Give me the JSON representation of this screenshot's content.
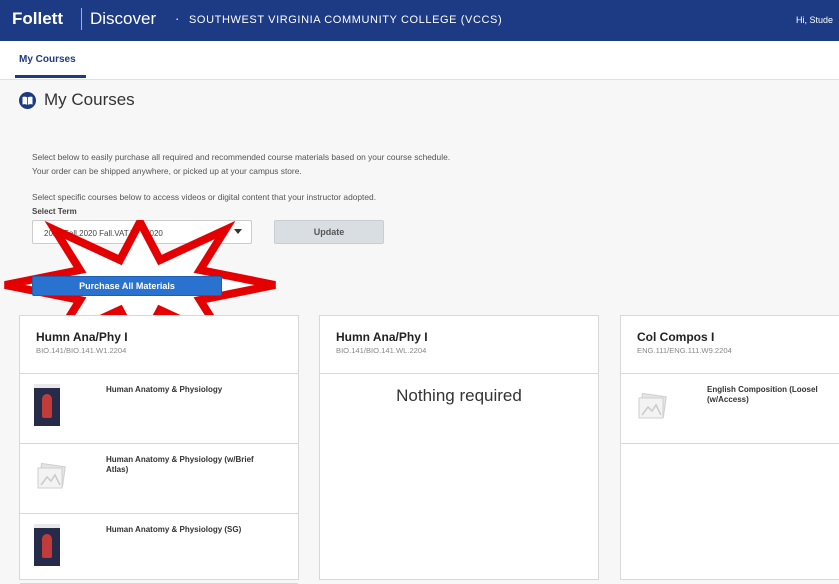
{
  "header": {
    "brand": "Follett",
    "product": "Discover",
    "separator": "·",
    "college": "SOUTHWEST VIRGINIA COMMUNITY COLLEGE (VCCS)",
    "greeting": "Hi, Stude",
    "bg_color": "#1d3a84"
  },
  "nav": {
    "tab_label": "My Courses"
  },
  "page": {
    "title": "My Courses",
    "title_icon": "book-icon",
    "intro_lines": [
      "Select below to easily purchase all required and recommended course materials based on your course schedule.",
      "Your order can be shipped anywhere, or picked up at your campus store.",
      "Select specific courses below to access videos or digital content that your instructor adopted."
    ]
  },
  "term": {
    "label": "Select Term",
    "selected": "2020 Fall.2020 Fall.VAT.Fall 2020",
    "update_label": "Update"
  },
  "purchase": {
    "label": "Purchase All Materials",
    "color": "#2a72cf",
    "highlight": "red-star-burst"
  },
  "courses": [
    {
      "title": "Humn Ana/Phy I",
      "code": "BIO.141/BIO.141.W1.2204",
      "items": [
        {
          "title": "Human Anatomy & Physiology",
          "thumb": "book-cover"
        },
        {
          "title": "Human Anatomy & Physiology (w/Brief Atlas)",
          "thumb": "placeholder-image-icon"
        },
        {
          "title": "Human Anatomy & Physiology (SG)",
          "thumb": "book-cover"
        }
      ]
    },
    {
      "title": "Humn Ana/Phy I",
      "code": "BIO.141/BIO.141.WL.2204",
      "empty_message": "Nothing required"
    },
    {
      "title": "Col Compos I",
      "code": "ENG.111/ENG.111.W9.2204",
      "items": [
        {
          "title": "English Composition (Loosel (w/Access)",
          "thumb": "placeholder-image-icon"
        }
      ]
    }
  ]
}
